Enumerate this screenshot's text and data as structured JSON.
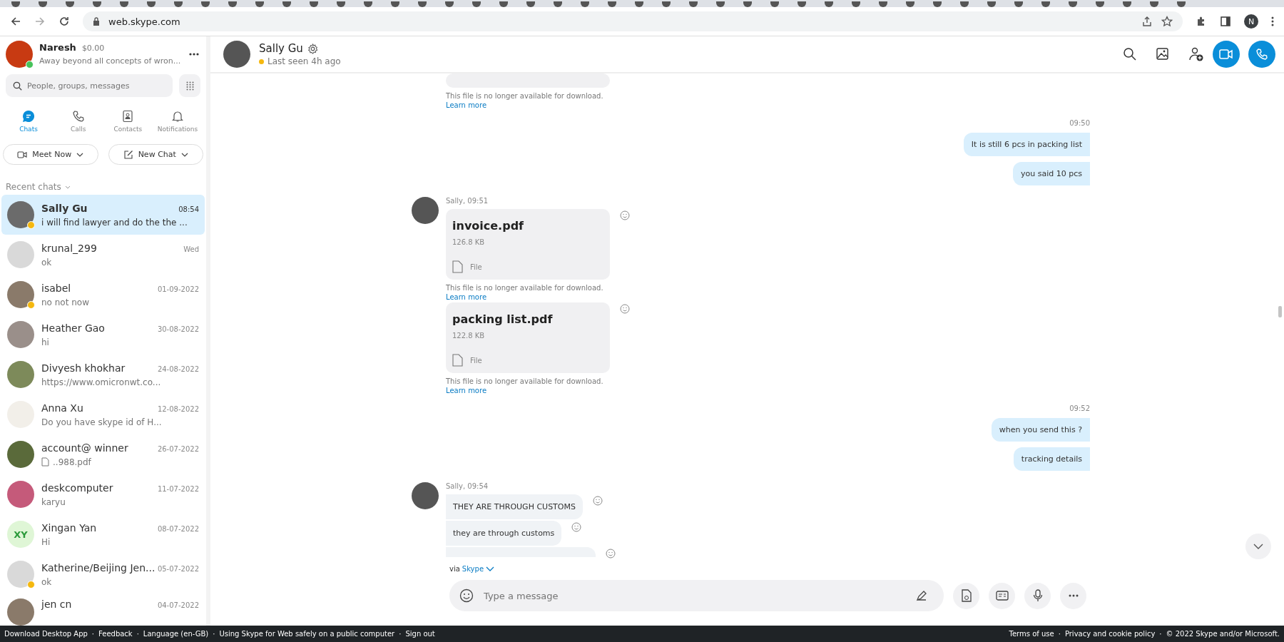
{
  "browser": {
    "url": "web.skype.com",
    "profile_initial": "N"
  },
  "profile": {
    "name": "Naresh",
    "credit": "$0.00",
    "mood": "Away beyond all concepts of wron...",
    "online": true
  },
  "search": {
    "placeholder": "People, groups, messages"
  },
  "nav_tabs": [
    {
      "label": "Chats",
      "selected": true
    },
    {
      "label": "Calls",
      "selected": false
    },
    {
      "label": "Contacts",
      "selected": false
    },
    {
      "label": "Notifications",
      "selected": false
    }
  ],
  "actions": [
    "Meet Now",
    "New Chat"
  ],
  "recent_chats_label": "Recent chats",
  "chats": [
    {
      "kind": "text",
      "name": "Sally Gu",
      "time": "08:54",
      "preview": "i will find lawyer and do the the ...",
      "selected": true,
      "away": true
    },
    {
      "kind": "text",
      "name": "krunal_299",
      "time": "Wed",
      "preview": "ok",
      "selected": false,
      "away": false
    },
    {
      "kind": "text",
      "name": "isabel",
      "time": "01-09-2022",
      "preview": "no not now",
      "selected": false,
      "away": true
    },
    {
      "kind": "text",
      "name": "Heather Gao",
      "time": "30-08-2022",
      "preview": "hi",
      "selected": false,
      "away": false
    },
    {
      "kind": "text",
      "name": "Divyesh khokhar",
      "time": "24-08-2022",
      "preview": "https://www.omicronwt.co...",
      "selected": false,
      "away": false
    },
    {
      "kind": "text",
      "name": "Anna Xu",
      "time": "12-08-2022",
      "preview": "Do you have skype id of H...",
      "selected": false,
      "away": false
    },
    {
      "kind": "file",
      "name": "account@ winner",
      "time": "26-07-2022",
      "preview": "..988.pdf",
      "selected": false,
      "away": false
    },
    {
      "kind": "text",
      "name": "deskcomputer",
      "time": "11-07-2022",
      "preview": "karyu",
      "selected": false,
      "away": false
    },
    {
      "kind": "text",
      "name": "Xingan  Yan",
      "time": "08-07-2022",
      "preview": "Hi",
      "initials": "XY",
      "selected": false,
      "away": false
    },
    {
      "kind": "text",
      "name": "Katherine/Beijing Jen...",
      "time": "05-07-2022",
      "preview": "ok",
      "selected": false,
      "away": true
    },
    {
      "name": "jen cn",
      "time": "04-07-2022",
      "selected": false,
      "away": false
    }
  ],
  "conversation": {
    "name": "Sally Gu",
    "status": "Last seen 4h ago",
    "away": true
  },
  "messages": [
    {
      "kind": "file_tail",
      "notice": "This file is no longer available for download.",
      "link": "Learn more"
    },
    {
      "kind": "outgoing",
      "time": "09:50",
      "texts": [
        "It is still 6 pcs in packing list",
        "you said 10 pcs"
      ]
    },
    {
      "kind": "incoming",
      "sender": "Sally, 09:51",
      "items": [
        {
          "kind": "file",
          "name": "invoice.pdf",
          "size": "126.8 KB",
          "type": "File",
          "notice": "This file is no longer available for download.",
          "link": "Learn more"
        },
        {
          "kind": "file",
          "name": "packing list.pdf",
          "size": "122.8 KB",
          "type": "File",
          "notice": "This file is no longer available for download.",
          "link": "Learn more"
        }
      ]
    },
    {
      "kind": "outgoing",
      "time": "09:52",
      "texts": [
        "when you send this ?",
        "tracking details"
      ]
    },
    {
      "kind": "incoming",
      "sender": "Sally, 09:54",
      "items": [
        {
          "kind": "text",
          "text": "THEY ARE THROUGH CUSTOMS"
        },
        {
          "kind": "text",
          "text": "they are through customs"
        },
        {
          "kind": "cut"
        }
      ]
    }
  ],
  "via": {
    "prefix": "via",
    "link": "Skype"
  },
  "composer": {
    "placeholder": "Type a message"
  },
  "footer": {
    "separator": "·",
    "left": [
      "Download Desktop App",
      "Feedback",
      "Language (en-GB)",
      "Using Skype for Web safely on a public computer",
      "Sign out"
    ],
    "right": [
      "Terms of use",
      "Privacy and cookie policy",
      "© 2022 Skype and/or Microsoft."
    ]
  }
}
